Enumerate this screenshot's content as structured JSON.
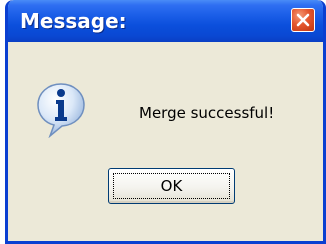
{
  "window": {
    "title": "Message:",
    "close_icon": "close-icon",
    "accent_color": "#0a3fd1",
    "close_color": "#e4572f",
    "background_color": "#ece9d8"
  },
  "dialog": {
    "icon": "info-icon",
    "message": "Merge successful!",
    "ok_label": "OK"
  }
}
